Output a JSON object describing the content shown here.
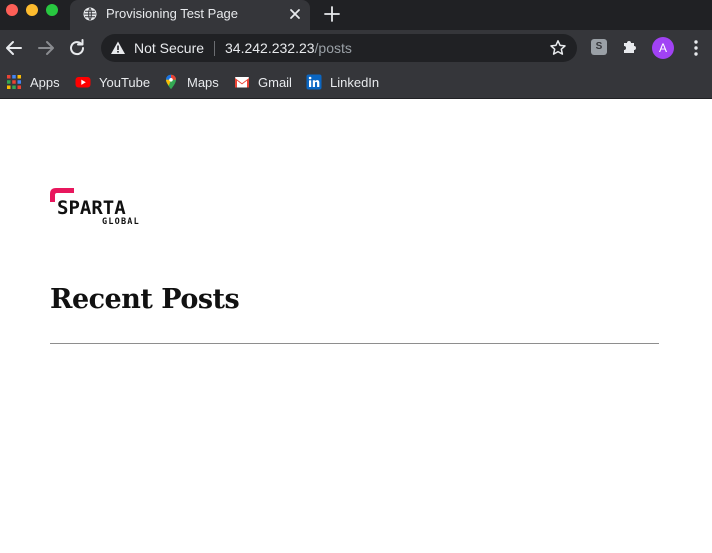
{
  "tab": {
    "title": "Provisioning Test Page"
  },
  "omnibox": {
    "security_label": "Not Secure",
    "url_host": "34.242.232.23",
    "url_path": "/posts"
  },
  "profile": {
    "initial": "A",
    "color": "#a142f4"
  },
  "extension": {
    "label": "S"
  },
  "bookmarks": [
    {
      "label": "Apps",
      "icon": "apps-grid-icon"
    },
    {
      "label": "YouTube",
      "icon": "youtube-icon"
    },
    {
      "label": "Maps",
      "icon": "maps-pin-icon"
    },
    {
      "label": "Gmail",
      "icon": "gmail-icon"
    },
    {
      "label": "LinkedIn",
      "icon": "linkedin-icon"
    }
  ],
  "page": {
    "logo_text": "SPARTA",
    "logo_subtext": "GLOBAL",
    "heading": "Recent Posts"
  },
  "colors": {
    "brand_accent": "#e8175d",
    "chrome_dark": "#202124",
    "chrome_toolbar": "#35363a"
  }
}
